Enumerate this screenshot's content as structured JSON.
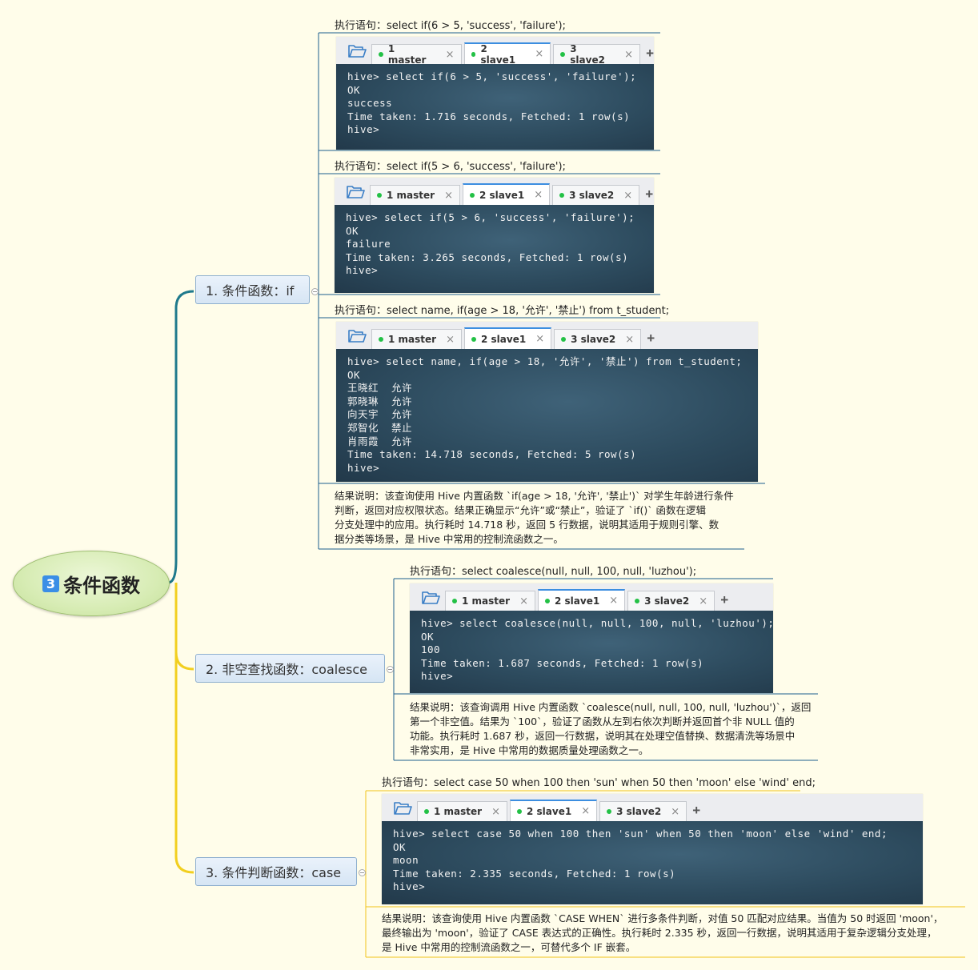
{
  "root": {
    "badge": "3",
    "label": "条件函数"
  },
  "branches": [
    {
      "label": "1. 条件函数：if"
    },
    {
      "label": "2. 非空查找函数：coalesce"
    },
    {
      "label": "3. 条件判断函数：case"
    }
  ],
  "tabs": [
    {
      "label": "1 master",
      "close": "×"
    },
    {
      "label": "2 slave1",
      "close": "×"
    },
    {
      "label": "3 slave2",
      "close": "×"
    }
  ],
  "add_tab": "+",
  "nodes": [
    {
      "label": "执行语句：select if(6 > 5, 'success', 'failure');",
      "terminal": [
        "hive> select if(6 > 5, 'success', 'failure');",
        "OK",
        "success",
        "Time taken: 1.716 seconds, Fetched: 1 row(s)",
        "hive>"
      ]
    },
    {
      "label": "执行语句：select if(5 > 6, 'success', 'failure');",
      "terminal": [
        "hive> select if(5 > 6, 'success', 'failure');",
        "OK",
        "failure",
        "Time taken: 3.265 seconds, Fetched: 1 row(s)",
        "hive>"
      ]
    },
    {
      "label": "执行语句：select name, if(age > 18, '允许', '禁止') from t_student;",
      "terminal": [
        "hive> select name, if(age > 18, '允许', '禁止') from t_student;",
        "OK",
        "王晓红  允许",
        "郭晓琳  允许",
        "向天宇  允许",
        "郑智化  禁止",
        "肖雨霞  允许",
        "Time taken: 14.718 seconds, Fetched: 5 row(s)",
        "hive>"
      ],
      "note": [
        "结果说明：该查询使用 Hive 内置函数 `if(age > 18, '允许', '禁止')` 对学生年龄进行条件",
        "判断，返回对应权限状态。结果正确显示“允许”或“禁止”，验证了 `if()` 函数在逻辑",
        "分支处理中的应用。执行耗时 14.718 秒，返回 5 行数据，说明其适用于规则引擎、数",
        "据分类等场景，是 Hive 中常用的控制流函数之一。"
      ]
    },
    {
      "label": "执行语句：select coalesce(null, null, 100, null, 'luzhou');",
      "terminal": [
        "hive> select coalesce(null, null, 100, null, 'luzhou');",
        "OK",
        "100",
        "Time taken: 1.687 seconds, Fetched: 1 row(s)",
        "hive>"
      ],
      "note": [
        "结果说明：该查询调用 Hive 内置函数 `coalesce(null, null, 100, null, 'luzhou')`，返回",
        "第一个非空值。结果为 `100`，验证了函数从左到右依次判断并返回首个非 NULL 值的",
        "功能。执行耗时 1.687 秒，返回一行数据，说明其在处理空值替换、数据清洗等场景中",
        "非常实用，是 Hive 中常用的数据质量处理函数之一。"
      ]
    },
    {
      "label": "执行语句：select case 50 when 100 then 'sun' when 50 then 'moon' else 'wind' end;",
      "terminal": [
        "hive> select case 50 when 100 then 'sun' when 50 then 'moon' else 'wind' end;",
        "OK",
        "moon",
        "Time taken: 2.335 seconds, Fetched: 1 row(s)",
        "hive>"
      ],
      "note": [
        "结果说明：该查询使用 Hive 内置函数 `CASE WHEN` 进行多条件判断，对值 50 匹配对应结果。当值为 50 时返回 'moon'，",
        "最终输出为 'moon'，验证了 CASE 表达式的正确性。执行耗时 2.335 秒，返回一行数据，说明其适用于复杂逻辑分支处理，",
        "是 Hive 中常用的控制流函数之一，可替代多个 IF 嵌套。"
      ]
    }
  ],
  "colors": {
    "background": "#fffdea",
    "branch_if": "#1f7a8c",
    "branch_case": "#f2cf1f",
    "node_line_blue": "#1e5f8e",
    "node_line_yellow": "#f0c419"
  }
}
